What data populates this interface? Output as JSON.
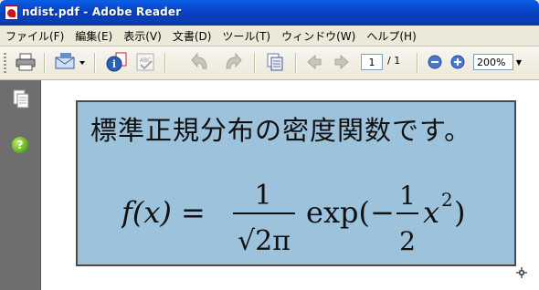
{
  "window": {
    "title": "ndist.pdf - Adobe Reader"
  },
  "menu": {
    "items": [
      "ファイル(F)",
      "編集(E)",
      "表示(V)",
      "文書(D)",
      "ツール(T)",
      "ウィンドウ(W)",
      "ヘルプ(H)"
    ]
  },
  "toolbar": {
    "page_current": "1",
    "page_total": "/ 1",
    "zoom_value": "200%",
    "icons": [
      "printer-icon",
      "email-icon",
      "document-properties-icon",
      "spellcheck-icon",
      "rotate-left-icon",
      "rotate-right-icon",
      "copy-pages-icon",
      "previous-page-icon",
      "next-page-icon",
      "zoom-out-icon",
      "zoom-in-icon"
    ]
  },
  "document": {
    "heading": "標準正規分布の密度関数です。",
    "formula": {
      "lhs": "f(x) =",
      "frac_num": "1",
      "frac_den": "√2π",
      "func": "exp(−",
      "half_num": "1",
      "half_den": "2",
      "tail_base": "x",
      "tail_exp": "2",
      "tail_close": ")"
    }
  },
  "colors": {
    "titlebar": "#0842c4",
    "box_fill": "#9cc2dc",
    "nav_panel": "#6e6e6e"
  }
}
